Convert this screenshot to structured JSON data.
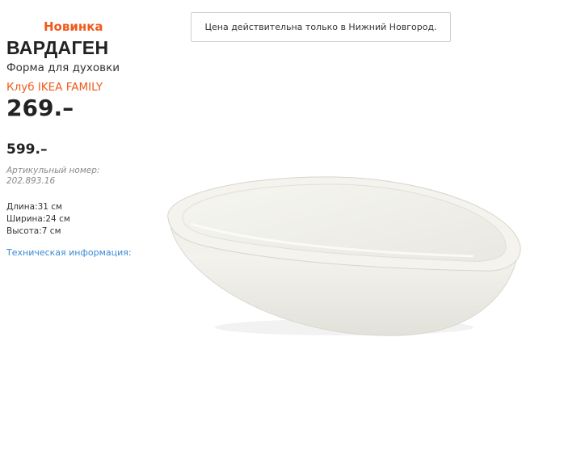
{
  "product": {
    "badge": "Новинка",
    "name": "ВАРДАГЕН",
    "description": "Форма для духовки",
    "family_label": "Клуб IKEA FAMILY",
    "family_price": "269.–",
    "regular_price": "599.–",
    "article": "Артикульный номер: 202.893.16",
    "dimensions": [
      "Длина:31 см",
      "Ширина:24 см",
      "Высота:7 см"
    ],
    "tech_info_link": "Техническая информация:",
    "image_icon": "oval-baking-dish"
  },
  "notice": {
    "text": "Цена действительна только в Нижний Новгород."
  },
  "colors": {
    "accent": "#f05a1a",
    "link": "#3a8ad4"
  }
}
